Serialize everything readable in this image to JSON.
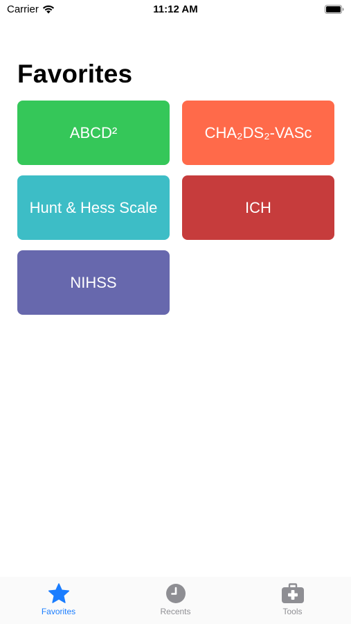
{
  "status_bar": {
    "carrier": "Carrier",
    "time": "11:12 AM"
  },
  "page": {
    "title": "Favorites"
  },
  "tiles": [
    {
      "label": "ABCD²",
      "color": "#35c759"
    },
    {
      "label": "CHA₂DS₂-VASc",
      "color": "#ff6a4a"
    },
    {
      "label": "Hunt & Hess Scale",
      "color": "#3dbdc6"
    },
    {
      "label": "ICH",
      "color": "#c63c3c"
    },
    {
      "label": "NIHSS",
      "color": "#6768ad"
    }
  ],
  "tab_bar": {
    "tabs": [
      {
        "label": "Favorites",
        "icon": "star-icon",
        "active": true
      },
      {
        "label": "Recents",
        "icon": "clock-icon",
        "active": false
      },
      {
        "label": "Tools",
        "icon": "medical-kit-icon",
        "active": false
      }
    ],
    "active_color": "#1a7dff",
    "inactive_color": "#8e8e93"
  }
}
